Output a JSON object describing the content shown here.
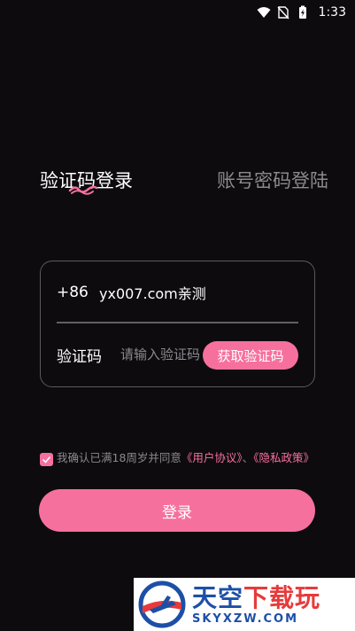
{
  "status_bar": {
    "time": "1:33",
    "icons": [
      "wifi-icon",
      "no-sim-icon",
      "battery-charging-icon"
    ]
  },
  "tabs": {
    "active_label": "验证码登录",
    "inactive_label": "账号密码登陆"
  },
  "form": {
    "country_code": "+86",
    "phone_value": "yx007.com亲测",
    "code_label": "验证码",
    "code_placeholder": "请输入验证码",
    "get_code_label": "获取验证码"
  },
  "agreement": {
    "checked": true,
    "text_prefix": "我确认已满18周岁并同意",
    "user_agreement": "《用户协议》",
    "separator": "、",
    "privacy_policy": "《隐私政策》"
  },
  "login_button": "登录",
  "watermark": {
    "title_part1": "天空",
    "title_part2": "下载玩",
    "subtitle": "SKYXZW.COM"
  },
  "colors": {
    "accent": "#f6709e",
    "background": "#0d0b0e",
    "muted_text": "#8a8a8f",
    "border": "#5a5a60"
  }
}
